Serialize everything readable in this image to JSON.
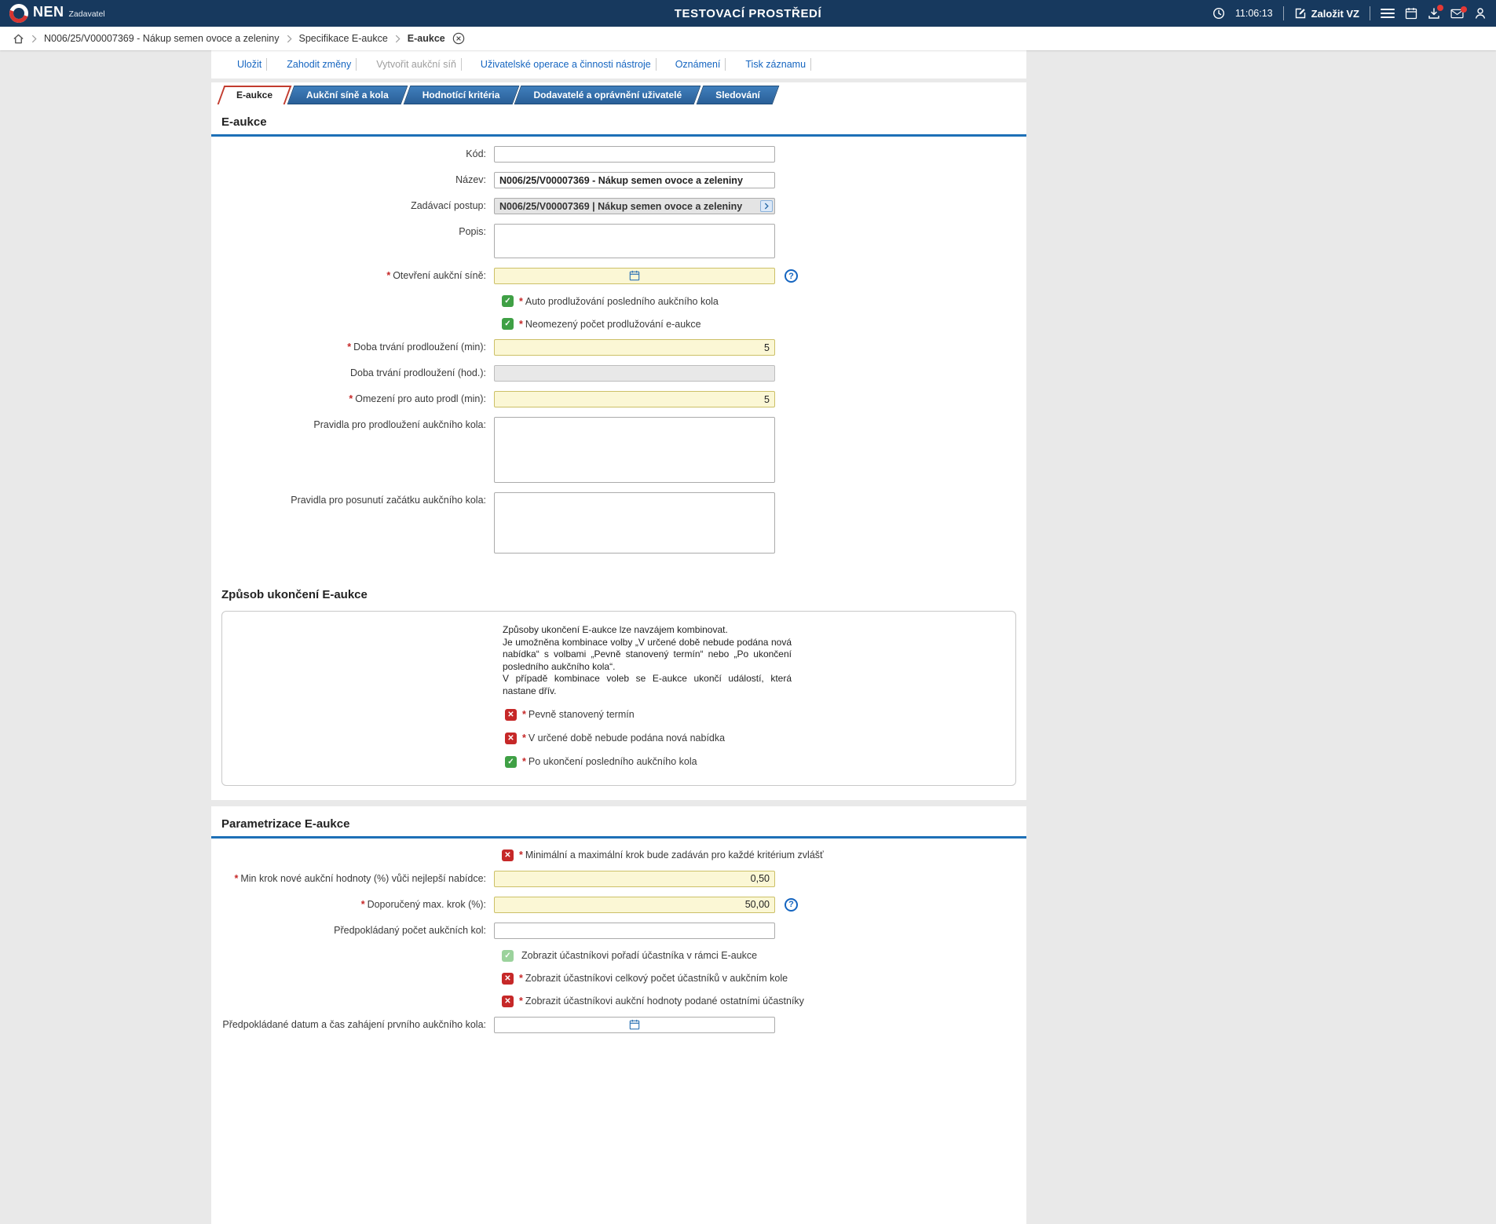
{
  "colors": {
    "header_bg": "#17395E",
    "accent": "#1565C0",
    "section_line": "#1D70B7",
    "tab_blue": "#3F7FBC",
    "tab_blue_dark": "#2A5F98",
    "tab_border": "#1C4A78",
    "active_tab_border": "#C23B2E",
    "required_red": "#C62828",
    "check_green": "#3FA045",
    "check_green_disabled": "#9BD29C",
    "check_red": "#C62828",
    "field_yellow": "#FBF7D5",
    "field_yellow_border": "#CCC067",
    "badge_red": "#E53935"
  },
  "header": {
    "logo_text": "NEN",
    "logo_subtext": "Zadavatel",
    "env_title": "TESTOVACÍ PROSTŘEDÍ",
    "time": "11:06:13",
    "create_vz_label": "Založit VZ"
  },
  "breadcrumb": {
    "items": [
      "N006/25/V00007369 - Nákup semen ovoce a zeleniny",
      "Specifikace E-aukce",
      "E-aukce"
    ]
  },
  "toolbar": {
    "items": [
      {
        "label": "Uložit"
      },
      {
        "label": "Zahodit změny"
      },
      {
        "label": "Vytvořit aukční síň"
      },
      {
        "label": "Uživatelské operace a činnosti nástroje"
      },
      {
        "label": "Oznámení"
      },
      {
        "label": "Tisk záznamu"
      }
    ]
  },
  "tabs": [
    {
      "label": "E-aukce",
      "active": true
    },
    {
      "label": "Aukční síně a kola",
      "active": false
    },
    {
      "label": "Hodnotící kritéria",
      "active": false
    },
    {
      "label": "Dodavatelé a oprávnění uživatelé",
      "active": false
    },
    {
      "label": "Sledování",
      "active": false
    }
  ],
  "section_eaukce": {
    "title": "E-aukce",
    "fields": {
      "kod": {
        "label": "Kód:",
        "value": ""
      },
      "nazev": {
        "label": "Název:",
        "value": "N006/25/V00007369 - Nákup semen ovoce a zeleniny"
      },
      "zadavaci_postup": {
        "label": "Zadávací postup:",
        "value": "N006/25/V00007369 | Nákup semen ovoce a zeleniny"
      },
      "popis": {
        "label": "Popis:",
        "value": ""
      },
      "otevreni_aukcni_sine": {
        "label": "Otevření aukční síně:",
        "required": "*",
        "value": ""
      },
      "auto_prodluzovani": {
        "label": "Auto prodlužování posledního aukčního kola",
        "required": "*",
        "state": "checked"
      },
      "neomezeny_pocet": {
        "label": "Neomezený počet prodlužování e-aukce",
        "required": "*",
        "state": "checked"
      },
      "doba_trvani_min": {
        "label": "Doba trvání prodloužení (min):",
        "required": "*",
        "value": "5"
      },
      "doba_trvani_hod": {
        "label": "Doba trvání prodloužení (hod.):",
        "value": ""
      },
      "omezeni_auto_prodl": {
        "label": "Omezení pro auto prodl (min):",
        "required": "*",
        "value": "5"
      },
      "pravidla_prodlouzeni": {
        "label": "Pravidla pro prodloužení aukčního kola:",
        "value": ""
      },
      "pravidla_posunuti": {
        "label": "Pravidla pro posunutí začátku aukčního kola:",
        "value": ""
      }
    }
  },
  "section_zpusob": {
    "title": "Způsob ukončení E-aukce",
    "info_lines": [
      "Způsoby ukončení E-aukce lze navzájem kombinovat.",
      "Je umožněna kombinace volby „V určené době nebude podána nová nabídka“ s volbami „Pevně stanovený termín“ nebo „Po ukončení posledního aukčního kola“.",
      "V případě kombinace voleb se E-aukce ukončí událostí, která nastane dřív."
    ],
    "checkboxes": [
      {
        "label": "Pevně stanovený termín",
        "required": "*",
        "state": "unchecked"
      },
      {
        "label": "V určené době nebude podána nová nabídka",
        "required": "*",
        "state": "unchecked"
      },
      {
        "label": "Po ukončení posledního aukčního kola",
        "required": "*",
        "state": "checked"
      }
    ]
  },
  "section_parametrizace": {
    "title": "Parametrizace E-aukce",
    "checkbox_krok": {
      "label": "Minimální a maximální krok bude zadáván pro každé kritérium zvlášť",
      "required": "*",
      "state": "unchecked"
    },
    "fields": {
      "min_krok": {
        "label": "Min krok nové aukční hodnoty (%) vůči nejlepší nabídce:",
        "required": "*",
        "value": "0,50"
      },
      "max_krok": {
        "label": "Doporučený max. krok (%):",
        "required": "*",
        "value": "50,00"
      },
      "pocet_kol": {
        "label": "Předpokládaný počet aukčních kol:",
        "value": ""
      },
      "datum_zahajeni": {
        "label": "Předpokládané datum a čas zahájení prvního aukčního kola:",
        "value": ""
      }
    },
    "checkboxes": [
      {
        "label": "Zobrazit účastníkovi pořadí účastníka v rámci E-aukce",
        "required": "",
        "state": "checked-disabled"
      },
      {
        "label": "Zobrazit účastníkovi celkový počet účastníků v aukčním kole",
        "required": "*",
        "state": "unchecked"
      },
      {
        "label": "Zobrazit účastníkovi aukční hodnoty podané ostatními účastníky",
        "required": "*",
        "state": "unchecked"
      }
    ]
  }
}
